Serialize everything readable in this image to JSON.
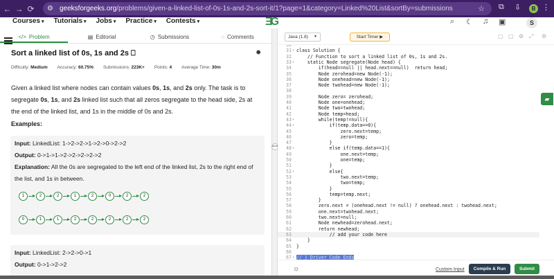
{
  "browser": {
    "url_host": "geeksforgeeks.org",
    "url_path": "/problems/given-a-linked-list-of-0s-1s-and-2s-sort-it/1?page=1&category=Linked%20List&sortBy=submissions",
    "profile_initial": "B"
  },
  "sitenav": {
    "items": [
      "Courses",
      "Tutorials",
      "Jobs",
      "Practice",
      "Contests"
    ],
    "logo": "ƎG",
    "user_initial": "S"
  },
  "tabs": [
    "Problem",
    "Editorial",
    "Submissions",
    "Comments"
  ],
  "problem": {
    "title": "Sort a linked list of 0s, 1s and 2s",
    "meta": {
      "difficulty_label": "Difficulty:",
      "difficulty": "Medium",
      "accuracy_label": "Accuracy:",
      "accuracy": "60.75%",
      "submissions_label": "Submissions:",
      "submissions": "223K+",
      "points_label": "Points:",
      "points": "4",
      "avg_time_label": "Average Time:",
      "avg_time": "30m"
    },
    "desc_1": "Given a linked list where nodes can contain values ",
    "desc_v0": "0s",
    "desc_c1": ", ",
    "desc_v1": "1s",
    "desc_c2": ", and ",
    "desc_v2": "2s",
    "desc_2": " only. The task is to segregate ",
    "desc_v3": "0s",
    "desc_c3": ", ",
    "desc_v4": "1s",
    "desc_c4": ", and ",
    "desc_v5": "2s",
    "desc_3": " linked list such that all zeros segregate to the head side, 2s at the end of the linked list, and 1s in the middle of 0s and 2s.",
    "examples_heading": "Examples:",
    "example1": {
      "input_label": "Input:",
      "input": " LinkedList: 1->2->2->1->2->0->2->2",
      "output_label": "Output:",
      "output": " 0->1->1->2->2->2->2->2",
      "explanation_label": "Explanation:",
      "explanation": " All the 0s are segregated to the left end of the linked list, 2s to the right end of the list, and 1s in between.",
      "list_before": [
        "1",
        "2",
        "2",
        "1",
        "2",
        "0",
        "2",
        "2"
      ],
      "list_after": [
        "0",
        "1",
        "1",
        "2",
        "2",
        "2",
        "2",
        "2"
      ]
    },
    "example2": {
      "input_label": "Input:",
      "input": " LinkedList: 2->2->0->1",
      "output_label": "Output:",
      "output": " 0->1->2->2"
    }
  },
  "editor": {
    "language": "Java (1.8)",
    "timer_label": "Start Timer",
    "lines": [
      {
        "n": "30",
        "t": ""
      },
      {
        "n": "31",
        "t": "class Solution {",
        "fold": true
      },
      {
        "n": "32",
        "t": "    // Function to sort a linked list of 0s, 1s and 2s."
      },
      {
        "n": "33",
        "t": "    static Node segregate(Node head) {",
        "fold": true
      },
      {
        "n": "34",
        "t": "        if(head==null || head.next==null)  return head;"
      },
      {
        "n": "35",
        "t": "        Node zerohead=new Node(-1);"
      },
      {
        "n": "36",
        "t": "        Node onehead=new Node(-1);"
      },
      {
        "n": "37",
        "t": "        Node twohead=new Node(-1);"
      },
      {
        "n": "38",
        "t": ""
      },
      {
        "n": "39",
        "t": "        Node zero= zerohead;"
      },
      {
        "n": "40",
        "t": "        Node one=onehead;"
      },
      {
        "n": "41",
        "t": "        Node two=twohead;"
      },
      {
        "n": "42",
        "t": "        Node temp=head;"
      },
      {
        "n": "43",
        "t": "        while(temp!=null){",
        "fold": true
      },
      {
        "n": "44",
        "t": "            if(temp.data==0){",
        "fold": true
      },
      {
        "n": "45",
        "t": "                zero.next=temp;"
      },
      {
        "n": "46",
        "t": "                zero=temp;"
      },
      {
        "n": "47",
        "t": "            }"
      },
      {
        "n": "48",
        "t": "            else if(temp.data==1){",
        "fold": true
      },
      {
        "n": "49",
        "t": "                one.next=temp;"
      },
      {
        "n": "50",
        "t": "                one=temp;"
      },
      {
        "n": "51",
        "t": "            }"
      },
      {
        "n": "52",
        "t": "            else{",
        "fold": true
      },
      {
        "n": "53",
        "t": "                two.next=temp;"
      },
      {
        "n": "54",
        "t": "                two=temp;"
      },
      {
        "n": "55",
        "t": "            }"
      },
      {
        "n": "56",
        "t": "            temp=temp.next;"
      },
      {
        "n": "57",
        "t": "        }"
      },
      {
        "n": "58",
        "t": "        zero.next = (onehead.next != null) ? onehead.next : twohead.next;"
      },
      {
        "n": "59",
        "t": "        one.next=twohead.next;"
      },
      {
        "n": "60",
        "t": "        two.next=null;"
      },
      {
        "n": "61",
        "t": "        Node newhead=zerohead.next;"
      },
      {
        "n": "62",
        "t": "        return newhead;"
      },
      {
        "n": "63",
        "t": "            // add your code here",
        "hl": true
      },
      {
        "n": "64",
        "t": "    }"
      },
      {
        "n": "65",
        "t": "}"
      },
      {
        "n": "66",
        "t": ""
      },
      {
        "n": "67",
        "t": "// } Driver Code Ends",
        "fold": true,
        "sel": true
      }
    ],
    "custom_input": "Custom Input",
    "compile_run": "Compile & Run",
    "submit": "Submit"
  }
}
